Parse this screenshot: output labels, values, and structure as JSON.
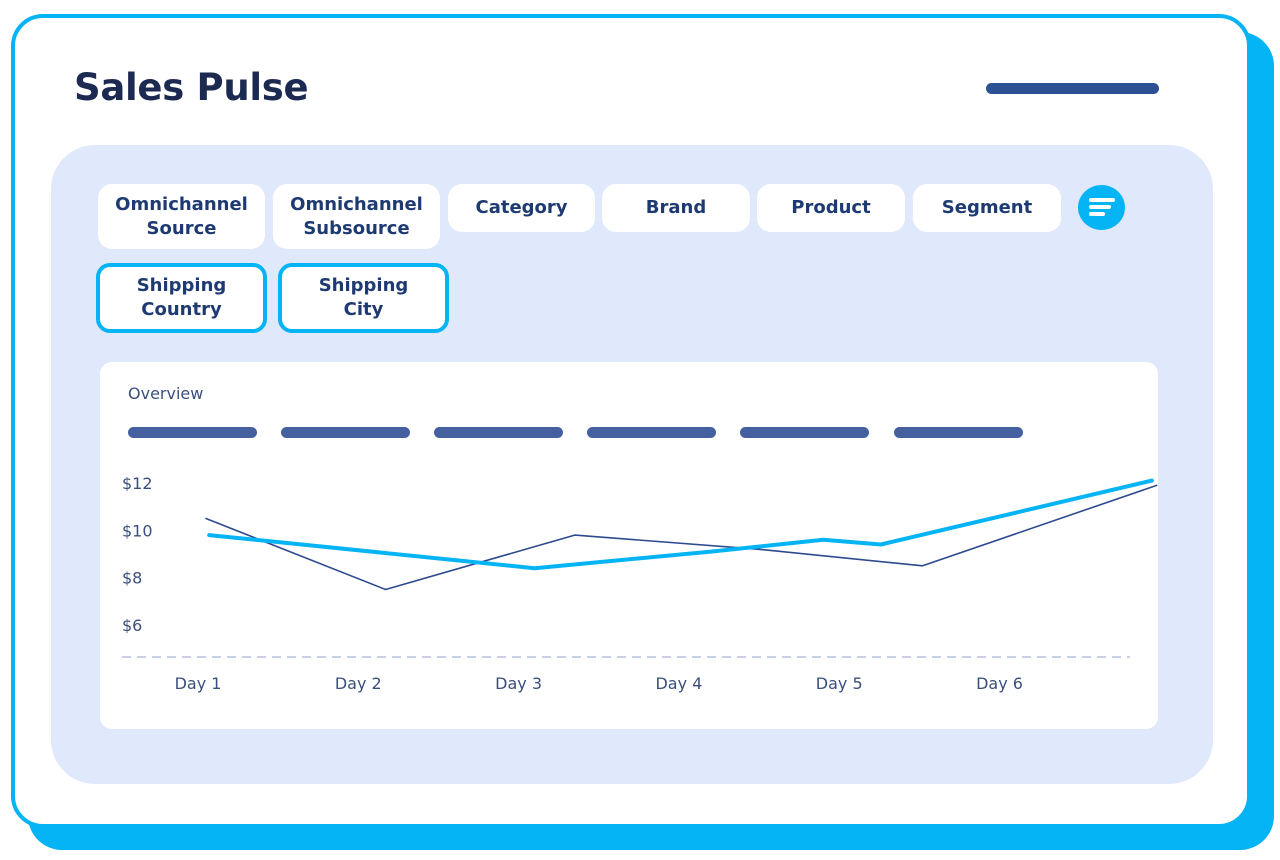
{
  "header": {
    "title": "Sales Pulse"
  },
  "filters": {
    "chips": [
      {
        "label": "Omnichannel\nSource",
        "active": false
      },
      {
        "label": "Omnichannel\nSubsource",
        "active": false
      },
      {
        "label": "Category",
        "active": false
      },
      {
        "label": "Brand",
        "active": false
      },
      {
        "label": "Product",
        "active": false
      },
      {
        "label": "Segment",
        "active": false
      },
      {
        "label": "Shipping\nCountry",
        "active": true
      },
      {
        "label": "Shipping\nCity",
        "active": true
      }
    ],
    "menu_icon": "filter-lines-icon"
  },
  "chart_card": {
    "title": "Overview"
  },
  "colors": {
    "accent": "#04b4f4",
    "navy": "#1c2a52",
    "panel": "#e0e8fb",
    "series_dark": "#2d4a8f"
  },
  "chart_data": {
    "type": "line",
    "categories": [
      "Day 1",
      "Day 2",
      "Day 3",
      "Day 4",
      "Day 5",
      "Day 6",
      ""
    ],
    "y_ticks": [
      "$12",
      "$10",
      "$8",
      "$6"
    ],
    "ylim": [
      4.7,
      12.9
    ],
    "series": [
      {
        "values": [
          10.5,
          7.5,
          9.8,
          9.2,
          8.5,
          null,
          11.9
        ],
        "color": "#2d4a8f",
        "x_positions": [
          0.05,
          1.17,
          2.35,
          3.5,
          4.52,
          null,
          5.98
        ]
      },
      {
        "values": [
          9.8,
          null,
          8.4,
          9.1,
          9.6,
          9.4,
          12.1
        ],
        "color": "#04b4f4",
        "x_positions": [
          0.07,
          null,
          2.1,
          3.2,
          3.9,
          4.26,
          5.95
        ]
      }
    ]
  }
}
